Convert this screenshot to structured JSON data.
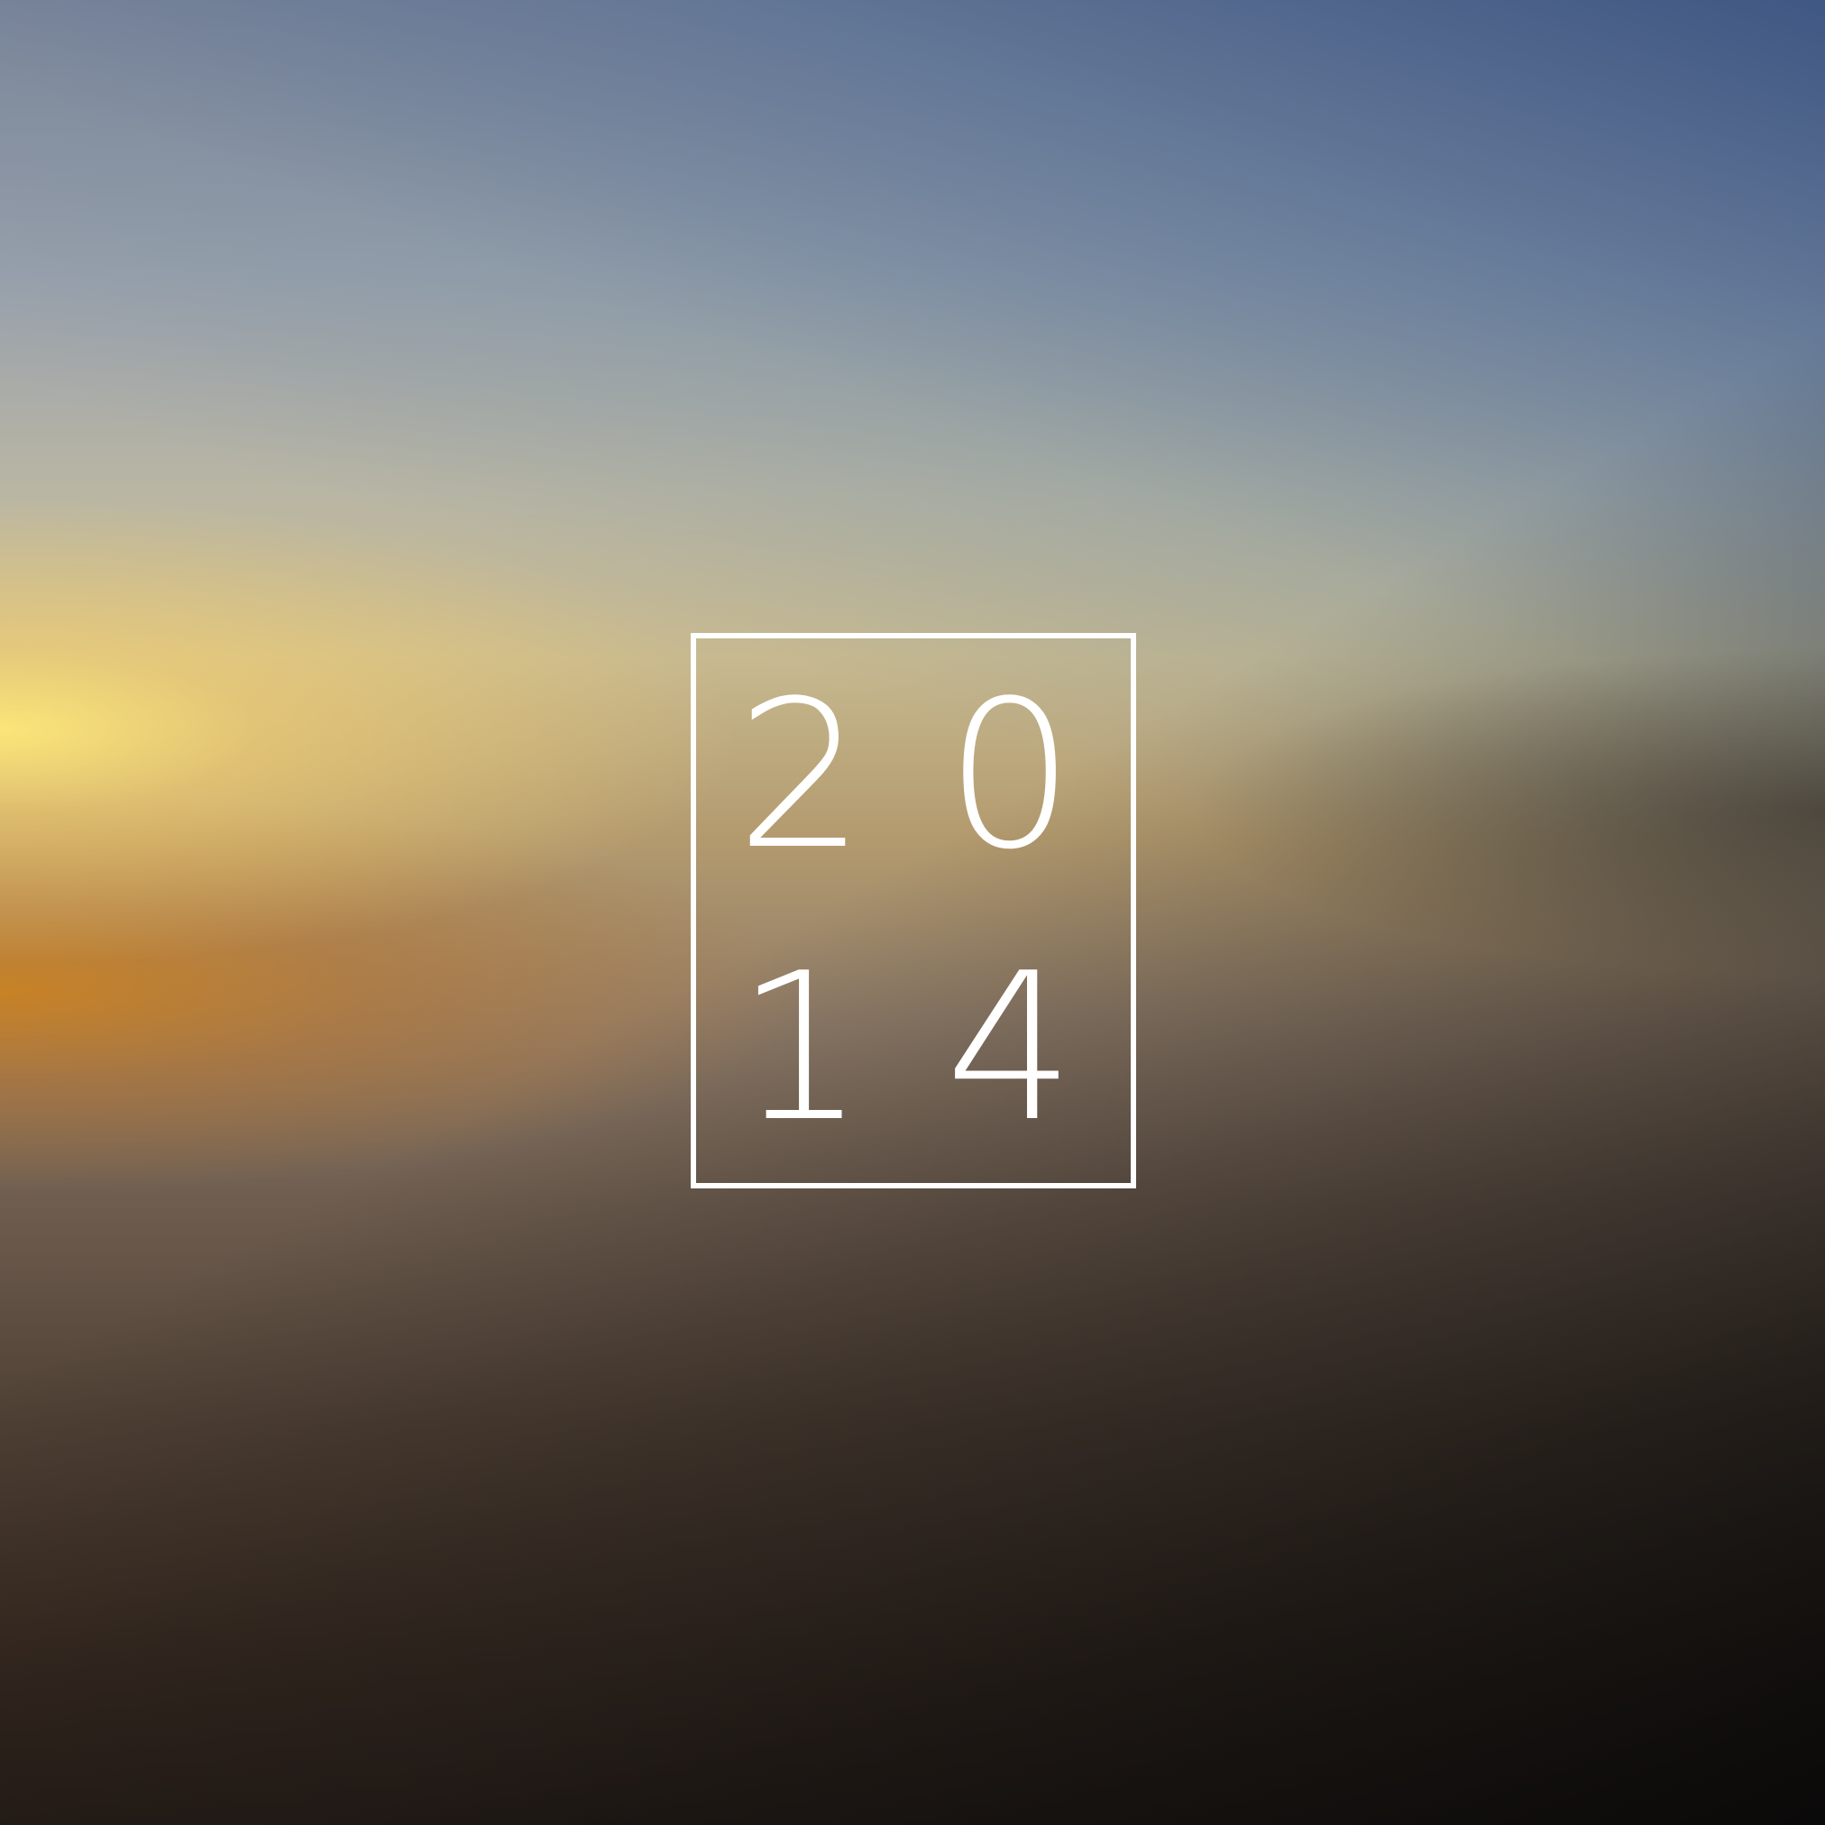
{
  "year_mark": {
    "digits": [
      "2",
      "0",
      "1",
      "4"
    ]
  },
  "colors": {
    "frame": "#ffffff",
    "digits": "#ffffff",
    "sky_top": "#4a5f85",
    "sun_glow": "#ffe27a",
    "horizon_amber": "#c8801c",
    "bottom_dark": "#0d0b0b"
  }
}
